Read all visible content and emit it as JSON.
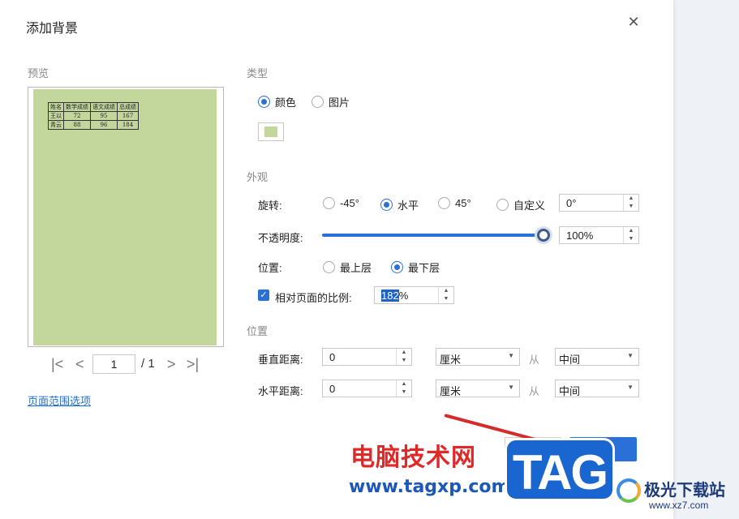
{
  "dialog": {
    "title": "添加背景",
    "close_icon": "close-icon"
  },
  "preview": {
    "label": "预览",
    "table": {
      "headers": [
        "姓名",
        "数学成绩",
        "语文成绩",
        "总成绩"
      ],
      "rows": [
        [
          "王以",
          "72",
          "95",
          "167"
        ],
        [
          "青云",
          "88",
          "96",
          "184"
        ]
      ]
    },
    "pager": {
      "current": "1",
      "total": "/ 1"
    },
    "range_link": "页面范围选项"
  },
  "type": {
    "label": "类型",
    "options": [
      "颜色",
      "图片"
    ],
    "selected": "颜色",
    "color": "#c3d69c"
  },
  "appearance": {
    "label": "外观",
    "rotation_label": "旋转:",
    "rotation_options": [
      "-45°",
      "水平",
      "45°",
      "自定义"
    ],
    "rotation_selected": "水平",
    "rotation_value": "0°",
    "opacity_label": "不透明度:",
    "opacity_value": "100%",
    "opacity_fraction": 1.0,
    "layer_label": "位置:",
    "layer_options": [
      "最上层",
      "最下层"
    ],
    "layer_selected": "最下层",
    "scale_label": "相对页面的比例:",
    "scale_value_selected": "182",
    "scale_value_suffix": "%",
    "scale_checked": true
  },
  "position": {
    "label": "位置",
    "vertical_label": "垂直距离:",
    "vertical_value": "0",
    "vertical_unit": "厘米",
    "vertical_from": "从",
    "vertical_anchor": "中间",
    "horizontal_label": "水平距离:",
    "horizontal_value": "0",
    "horizontal_unit": "厘米",
    "horizontal_from": "从",
    "horizontal_anchor": "中间"
  },
  "watermark": {
    "cn_text": "电脑技术网",
    "url": "www.tagxp.com",
    "tag": "TAG",
    "site_name": "极光下载站",
    "site_url": "www.xz7.com"
  },
  "colors": {
    "accent": "#2b6fd8",
    "background_color": "#c3d69c"
  }
}
